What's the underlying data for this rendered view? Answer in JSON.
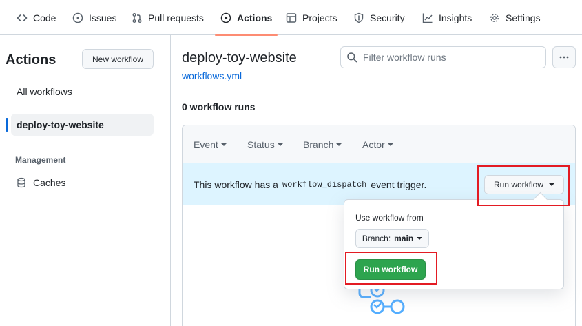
{
  "nav": {
    "tabs": [
      {
        "label": "Code",
        "icon": "code-icon"
      },
      {
        "label": "Issues",
        "icon": "issue-circle-icon"
      },
      {
        "label": "Pull requests",
        "icon": "pull-request-icon"
      },
      {
        "label": "Actions",
        "icon": "play-circle-icon",
        "active": true
      },
      {
        "label": "Projects",
        "icon": "table-icon"
      },
      {
        "label": "Security",
        "icon": "shield-icon"
      },
      {
        "label": "Insights",
        "icon": "graph-icon"
      },
      {
        "label": "Settings",
        "icon": "gear-icon"
      }
    ]
  },
  "sidebar": {
    "title": "Actions",
    "new_workflow": "New workflow",
    "items": [
      {
        "label": "All workflows"
      },
      {
        "label": "deploy-toy-website",
        "active": true
      }
    ],
    "management_label": "Management",
    "caches_label": "Caches"
  },
  "main": {
    "title": "deploy-toy-website",
    "file_link": "workflows.yml",
    "filter_placeholder": "Filter workflow runs",
    "runs_count": "0 workflow runs",
    "filters": [
      "Event",
      "Status",
      "Branch",
      "Actor"
    ],
    "trigger": {
      "prefix": "This workflow has a",
      "code": "workflow_dispatch",
      "suffix": "event trigger.",
      "button": "Run workflow"
    },
    "popover": {
      "label": "Use workflow from",
      "branch_prefix": "Branch:",
      "branch_value": "main",
      "submit": "Run workflow"
    }
  },
  "colors": {
    "accent_link": "#0969da",
    "active_tab_underline": "#fd8c73",
    "primary_green": "#2da44e",
    "info_banner": "#ddf4ff",
    "highlight_red": "#e31b23"
  }
}
